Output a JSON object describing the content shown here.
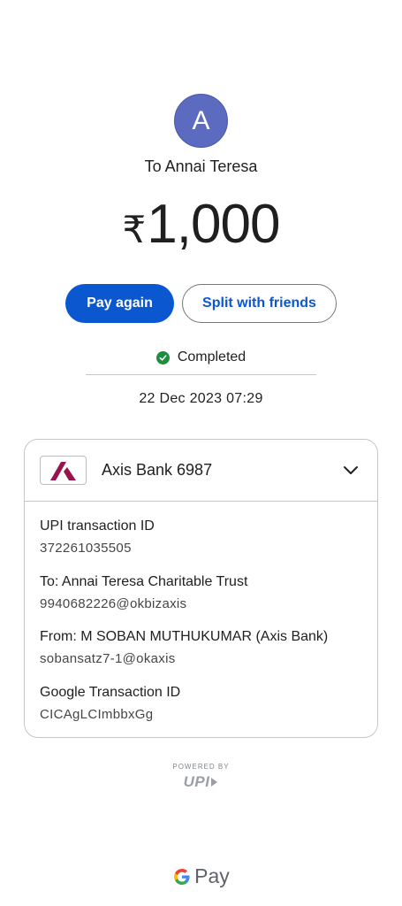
{
  "recipient": {
    "avatar_letter": "A",
    "avatar_color": "#5c6bc0",
    "title": "To Annai Teresa"
  },
  "payment": {
    "currency_symbol": "₹",
    "amount": "1,000"
  },
  "actions": {
    "pay_again": "Pay again",
    "split": "Split with friends"
  },
  "status": {
    "text": "Completed",
    "icon": "check-circle-icon",
    "color": "#1e8e3e"
  },
  "datetime": "22 Dec 2023 07:29",
  "account": {
    "bank": "Axis Bank 6987",
    "logo_icon": "axis-bank-logo",
    "brand_color": "#97144d"
  },
  "details": [
    {
      "label": "UPI transaction ID",
      "value": "372261035505"
    },
    {
      "label": "To: Annai Teresa Charitable Trust",
      "value": "9940682226@okbizaxis"
    },
    {
      "label": "From: M SOBAN MUTHUKUMAR (Axis Bank)",
      "value": "sobansatz7-1@okaxis"
    },
    {
      "label": "Google Transaction ID",
      "value": "CICAgLCImbbxGg"
    }
  ],
  "footer": {
    "powered_by": "POWERED BY",
    "upi_logo": "UPI",
    "gpay_logo_text": "Pay"
  },
  "accent": "#0b57d0"
}
